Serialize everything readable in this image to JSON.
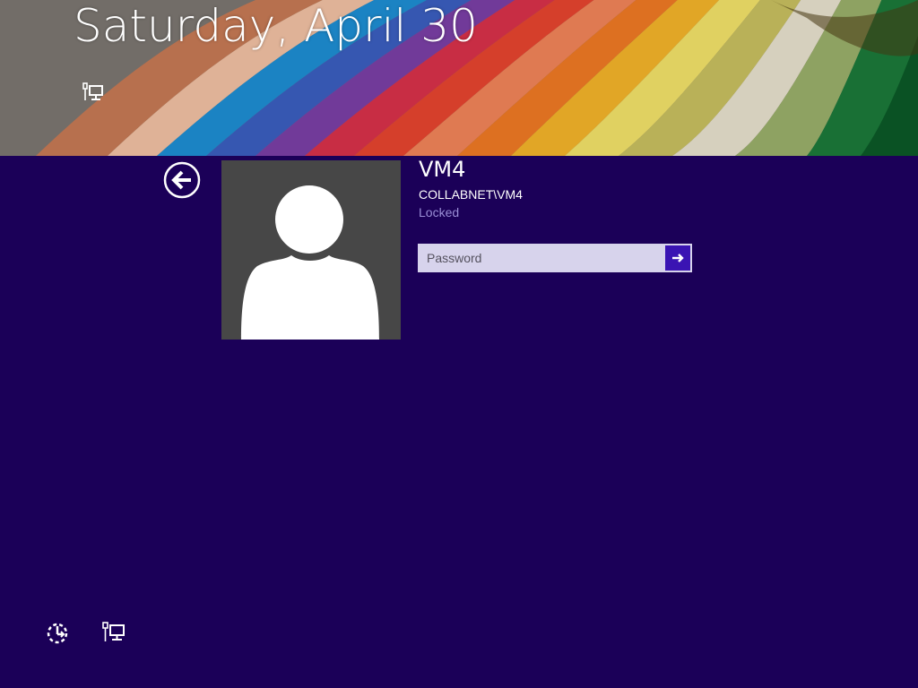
{
  "lock_screen": {
    "date": "Saturday, April 30"
  },
  "account": {
    "name": "VM4",
    "domain": "COLLABNET\\VM4",
    "status": "Locked"
  },
  "password": {
    "placeholder": "Password",
    "value": ""
  },
  "icons": {
    "back": "back-arrow-circle-icon",
    "submit": "arrow-right-icon",
    "network": "network-computer-icon",
    "ease_of_access": "ease-of-access-icon",
    "user": "user-silhouette-icon"
  },
  "colors": {
    "background": "#1b0058",
    "accent": "#3a14b3",
    "avatar_bg": "#474747",
    "input_bg": "#d7d3ec",
    "status_text": "#9a8ed6"
  }
}
